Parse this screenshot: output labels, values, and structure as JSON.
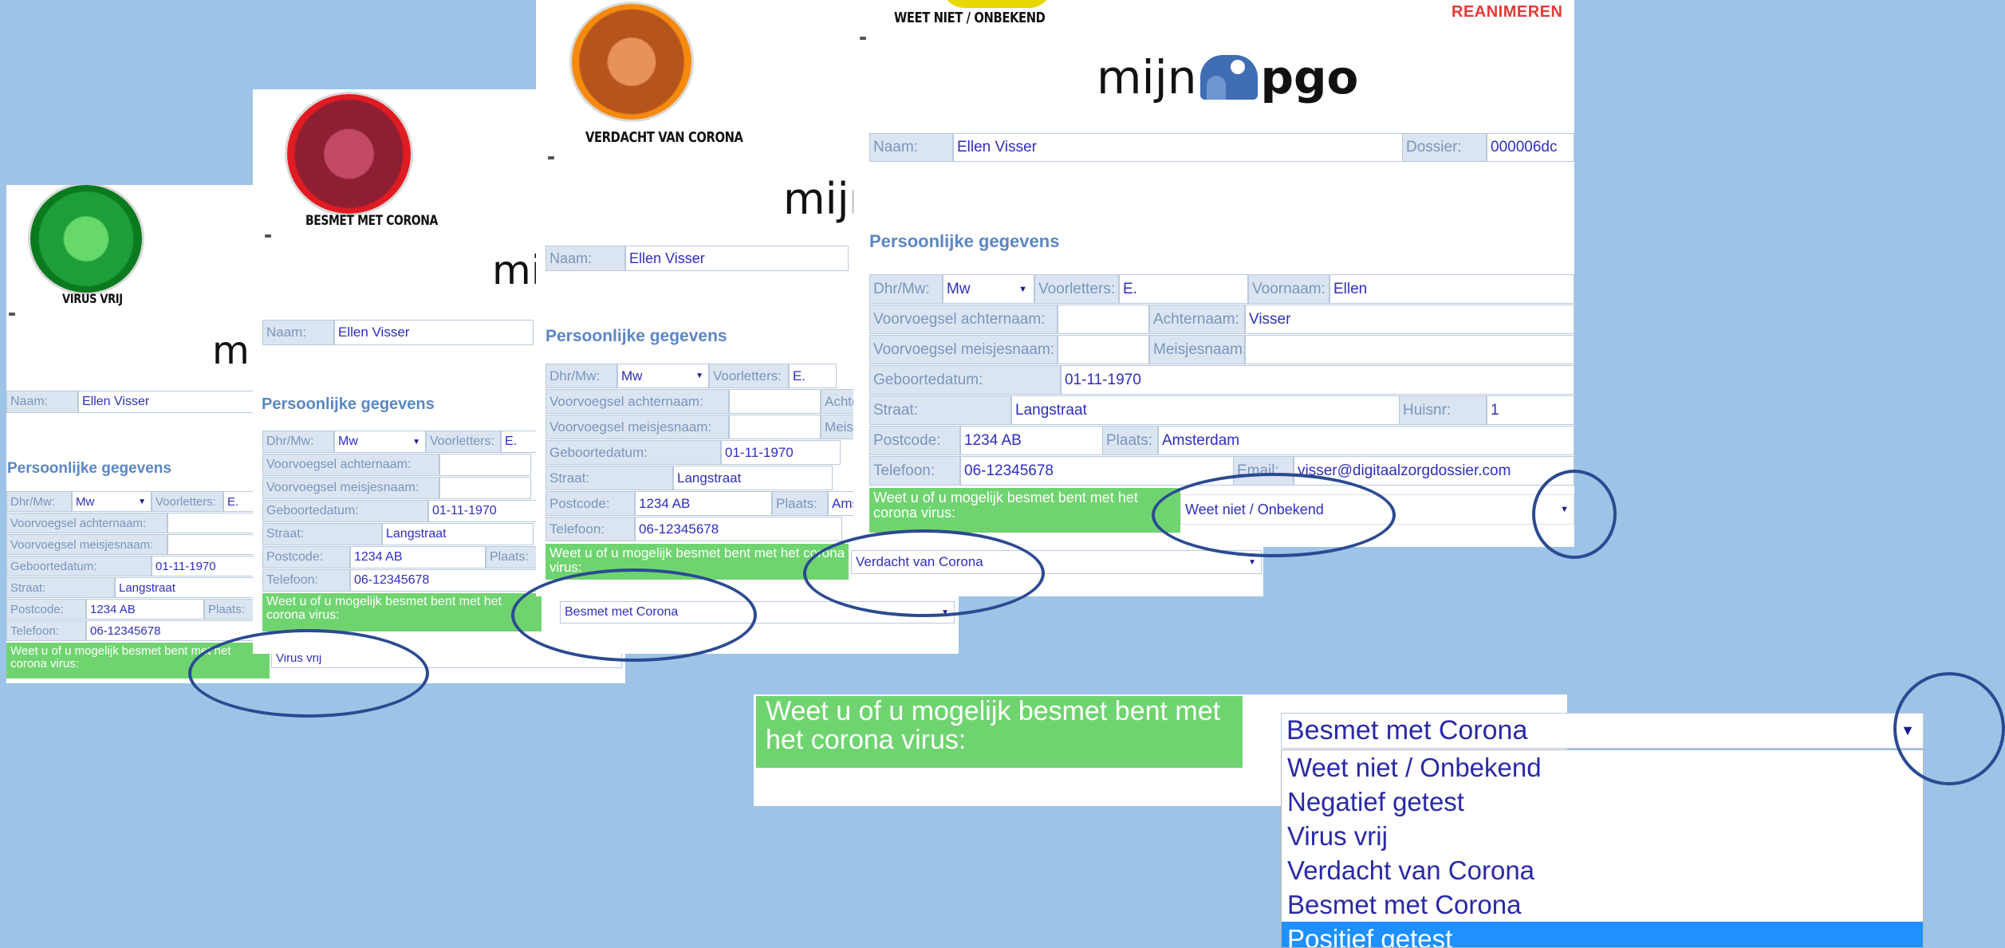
{
  "label": {
    "naam": "Naam:",
    "dossier": "Dossier:",
    "dhr_mw": "Dhr/Mw:",
    "voorletters": "Voorletters:",
    "voornaam": "Voornaam:",
    "voorvoegsel_achternaam": "Voorvoegsel achternaam:",
    "achternaam": "Achternaam:",
    "voorvoegsel_meisjesnaam": "Voorvoegsel meisjesnaam:",
    "meisjesnaam": "Meisjesnaam:",
    "geboortedatum": "Geboortedatum:",
    "straat": "Straat:",
    "huisnr": "Huisnr:",
    "postcode": "Postcode:",
    "plaats": "Plaats:",
    "telefoon": "Telefoon:",
    "email": "Email:"
  },
  "value": {
    "naam": "Ellen Visser",
    "dossier": "000006dc",
    "dhr_mw": "Mw",
    "voorletters": "E.",
    "voornaam": "Ellen",
    "achternaam": "Visser",
    "geboortedatum": "01-11-1970",
    "straat": "Langstraat",
    "huisnr": "1",
    "postcode": "1234  AB",
    "plaats": "Amsterdam",
    "telefoon": "06-12345678",
    "email": "visser@digitaalzorgdossier.com"
  },
  "section_title": "Persoonlijke gegevens",
  "question": "Weet u of u mogelijk besmet bent met het corona virus:",
  "logo": {
    "left": "mijn",
    "right": "pgo"
  },
  "reanimeren": "REANIMEREN",
  "cards": [
    {
      "status_caption": "VIRUS VRIJ",
      "color": "#22b14c",
      "selected": "Virus vrij"
    },
    {
      "status_caption": "BESMET MET CORONA",
      "color": "#e5232b",
      "selected": "Besmet met Corona"
    },
    {
      "status_caption": "VERDACHT VAN CORONA",
      "color": "#f7941d",
      "selected": "Verdacht van Corona"
    },
    {
      "status_caption": "WEET NIET / ONBEKEND",
      "color": "#f2e600",
      "selected": "Weet niet / Onbekend"
    }
  ],
  "dropdown": {
    "selected": "Besmet met Corona",
    "options": [
      "Weet niet / Onbekend",
      "Negatief getest",
      "Virus vrij",
      "Verdacht van Corona",
      "Besmet met Corona",
      "Positief getest"
    ],
    "highlighted": "Positief getest"
  },
  "icons": {
    "select_arrow": "▼"
  }
}
